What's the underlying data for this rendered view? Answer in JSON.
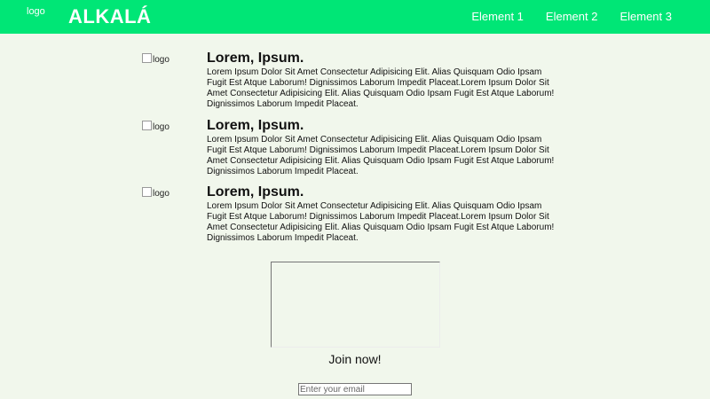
{
  "header": {
    "logo_alt": "logo",
    "brand": "ALKALÁ",
    "nav": [
      "Element 1",
      "Element 2",
      "Element 3"
    ]
  },
  "features": [
    {
      "logo_alt": "logo",
      "title": "Lorem, Ipsum.",
      "text": "Lorem Ipsum Dolor Sit Amet Consectetur Adipisicing Elit. Alias Quisquam Odio Ipsam Fugit Est Atque Laborum! Dignissimos Laborum Impedit Placeat.Lorem Ipsum Dolor Sit Amet Consectetur Adipisicing Elit. Alias Quisquam Odio Ipsam Fugit Est Atque Laborum! Dignissimos Laborum Impedit Placeat."
    },
    {
      "logo_alt": "logo",
      "title": "Lorem, Ipsum.",
      "text": "Lorem Ipsum Dolor Sit Amet Consectetur Adipisicing Elit. Alias Quisquam Odio Ipsam Fugit Est Atque Laborum! Dignissimos Laborum Impedit Placeat.Lorem Ipsum Dolor Sit Amet Consectetur Adipisicing Elit. Alias Quisquam Odio Ipsam Fugit Est Atque Laborum! Dignissimos Laborum Impedit Placeat."
    },
    {
      "logo_alt": "logo",
      "title": "Lorem, Ipsum.",
      "text": "Lorem Ipsum Dolor Sit Amet Consectetur Adipisicing Elit. Alias Quisquam Odio Ipsam Fugit Est Atque Laborum! Dignissimos Laborum Impedit Placeat.Lorem Ipsum Dolor Sit Amet Consectetur Adipisicing Elit. Alias Quisquam Odio Ipsam Fugit Est Atque Laborum! Dignissimos Laborum Impedit Placeat."
    }
  ],
  "signup": {
    "join_text": "Join now!",
    "email_placeholder": "Enter your email"
  },
  "colors": {
    "header_bg": "#00e676",
    "page_bg": "#f1f7ec"
  }
}
